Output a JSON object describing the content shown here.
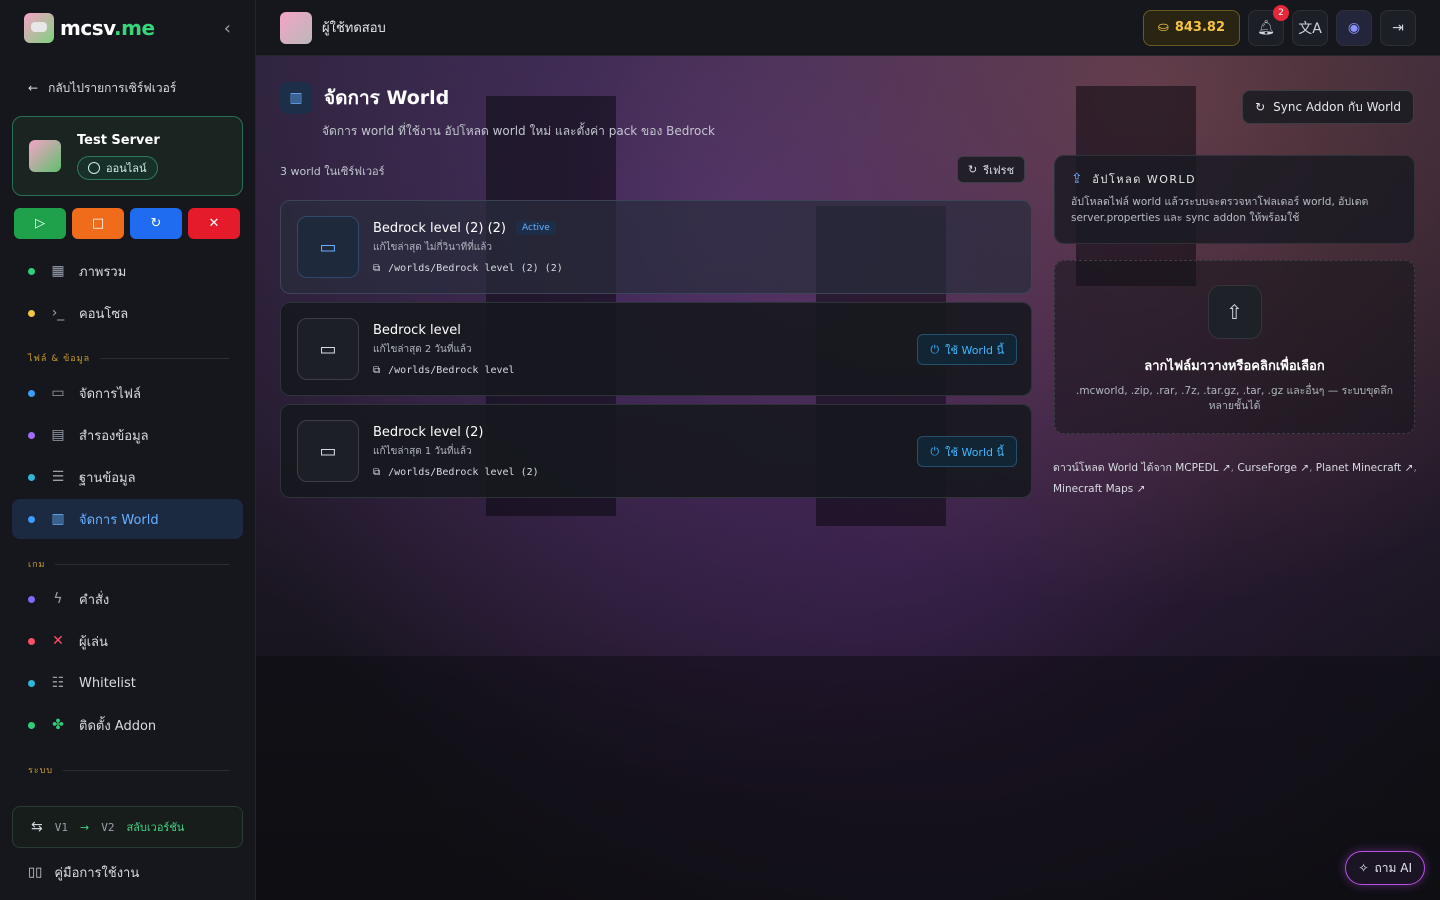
{
  "brand": {
    "name": "mcsv",
    "tld": ".me"
  },
  "sidebar": {
    "back_label": "กลับไปรายการเซิร์ฟเวอร์",
    "server": {
      "name": "Test Server",
      "status": "ออนไลน์"
    },
    "controls": {
      "start_icon": "▷",
      "stop_icon": "□",
      "restart_icon": "↻",
      "kill_icon": "✕"
    },
    "top_items": [
      {
        "label": "ภาพรวม",
        "icon": "grid-icon",
        "dot": "#2fd07a"
      },
      {
        "label": "คอนโซล",
        "icon": "terminal-icon",
        "dot": "#f4c542"
      }
    ],
    "section_files": "ไฟล์ & ข้อมูล",
    "file_items": [
      {
        "label": "จัดการไฟล์",
        "icon": "folder-icon",
        "dot": "#3b9dff"
      },
      {
        "label": "สำรองข้อมูล",
        "icon": "archive-icon",
        "dot": "#a06bff"
      },
      {
        "label": "ฐานข้อมูล",
        "icon": "database-icon",
        "dot": "#2fb7d7"
      },
      {
        "label": "จัดการ World",
        "icon": "map-icon",
        "dot": "#3b9dff",
        "active": true
      }
    ],
    "section_game": "เกม",
    "game_items": [
      {
        "label": "คำสั่ง",
        "icon": "bolt-icon",
        "dot": "#7a6bff"
      },
      {
        "label": "ผู้เล่น",
        "icon": "swords-icon",
        "dot": "#ff4d6a"
      },
      {
        "label": "Whitelist",
        "icon": "list-check-icon",
        "dot": "#2fb7d7"
      },
      {
        "label": "ติดตั้ง Addon",
        "icon": "puzzle-icon",
        "dot": "#2fd07a"
      }
    ],
    "section_system": "ระบบ",
    "switch_version": {
      "from": "V1",
      "arrow": "→",
      "to": "V2",
      "label": "สลับเวอร์ชัน"
    },
    "guide_label": "คู่มือการใช้งาน"
  },
  "topbar": {
    "user_name": "ผู้ใช้ทดสอบ",
    "coins": "843.82",
    "notification_count": "2"
  },
  "page": {
    "title": "จัดการ World",
    "subtitle": "จัดการ world ที่ใช้งาน อัปโหลด world ใหม่ และตั้งค่า pack ของ Bedrock",
    "sync_label": "Sync Addon กับ World",
    "world_count_label": "3 world ในเซิร์ฟเวอร์",
    "refresh_label": "รีเฟรช",
    "worlds": [
      {
        "name": "Bedrock level (2) (2)",
        "tag": "Active",
        "edited": "แก้ไขล่าสุด ไม่กี่วินาทีที่แล้ว",
        "path": "/worlds/Bedrock level (2) (2)",
        "active": true
      },
      {
        "name": "Bedrock level",
        "edited": "แก้ไขล่าสุด 2 วันที่แล้ว",
        "path": "/worlds/Bedrock level",
        "use_label": "ใช้ World นี้"
      },
      {
        "name": "Bedrock level (2)",
        "edited": "แก้ไขล่าสุด 1 วันที่แล้ว",
        "path": "/worlds/Bedrock level (2)",
        "use_label": "ใช้ World นี้"
      }
    ],
    "upload": {
      "title": "อัปโหลด WORLD",
      "description": "อัปโหลดไฟล์ world แล้วระบบจะตรวจหาโฟลเดอร์ world, อัปเดต server.properties และ sync addon ให้พร้อมใช้",
      "drop_title": "ลากไฟล์มาวางหรือคลิกเพื่อเลือก",
      "drop_sub": ".mcworld, .zip, .rar, .7z, .tar.gz, .tar, .gz และอื่นๆ — ระบบขุดลึกหลายชั้นได้"
    },
    "download_prefix": "ดาวน์โหลด World ได้จาก",
    "download_sites": [
      "MCPEDL",
      "CurseForge",
      "Planet Minecraft",
      "Minecraft Maps"
    ],
    "ai_label": "ถาม AI"
  }
}
